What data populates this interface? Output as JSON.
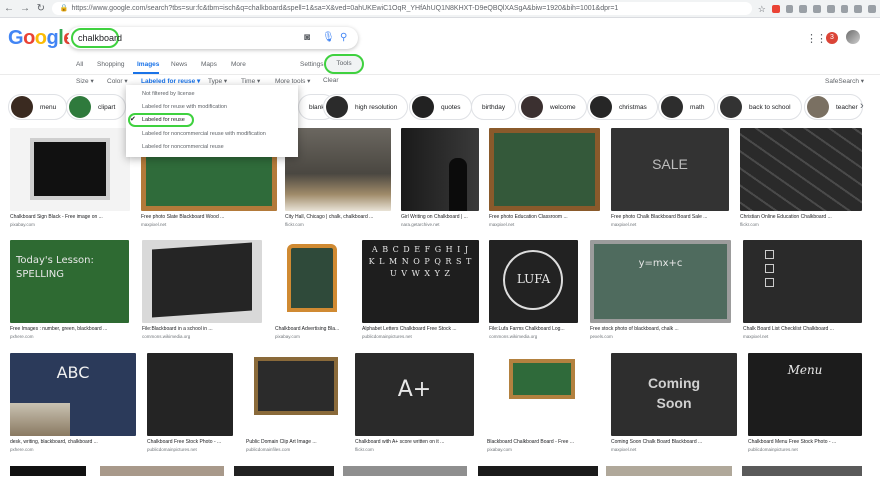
{
  "browser": {
    "url": "https://www.google.com/search?tbs=sur:fc&tbm=isch&q=chalkboard&spell=1&sa=X&ved=0ahUKEwiC1OqR_YHfAhUQ1N8KHXT-D9eQBQlXASgA&biw=1920&bih=1001&dpr=1"
  },
  "logo": [
    "G",
    "o",
    "o",
    "g",
    "l",
    "e"
  ],
  "search": {
    "query": "chalkboard"
  },
  "tabs": {
    "all": "All",
    "shopping": "Shopping",
    "images": "Images",
    "news": "News",
    "maps": "Maps",
    "more": "More",
    "settings": "Settings",
    "tools": "Tools"
  },
  "filters": {
    "size": "Size ▾",
    "color": "Color ▾",
    "usage": "Labeled for reuse ▾",
    "type": "Type ▾",
    "time": "Time ▾",
    "more_tools": "More tools ▾",
    "clear": "Clear",
    "safesearch": "SafeSearch ▾"
  },
  "header": {
    "notifications": "3"
  },
  "dropdown": {
    "items": [
      "Not filtered by license",
      "Labeled for reuse with modification",
      "Labeled for reuse",
      "Labeled for noncommercial reuse with modification",
      "Labeled for noncommercial reuse"
    ],
    "selected_index": 2
  },
  "chips": [
    "menu",
    "clipart",
    "blank",
    "high resolution",
    "quotes",
    "birthday",
    "welcome",
    "christmas",
    "math",
    "back to school",
    "teacher"
  ],
  "results": {
    "row1": [
      {
        "caption": "Chalkboard Sign Black - Free image on ...",
        "source": "pixabay.com"
      },
      {
        "caption": "Free photo Slate Blackboard Wood ...",
        "source": "maxpixel.net"
      },
      {
        "caption": "City Hall, Chicago | chalk, chalkboard ...",
        "source": "flickr.com"
      },
      {
        "caption": "Girl Writing on Chalkboard | ...",
        "source": "nara.getarchive.net"
      },
      {
        "caption": "Free photo Education Classroom ...",
        "source": "maxpixel.net"
      },
      {
        "caption": "Free photo Chalk Blackboard Board Sale ...",
        "source": "maxpixel.net"
      },
      {
        "caption": "Christian Online Education Chalkboard ...",
        "source": "flickr.com"
      }
    ],
    "row2": [
      {
        "caption": "Free Images : number, green, blackboard ...",
        "source": "pxhere.com"
      },
      {
        "caption": "File:Blackboard in a school in ...",
        "source": "commons.wikimedia.org"
      },
      {
        "caption": "Chalkboard Advertising Bla...",
        "source": "pixabay.com"
      },
      {
        "caption": "Alphabet Letters Chalkboard Free Stock ...",
        "source": "publicdomainpictures.net"
      },
      {
        "caption": "File:Lufa Farms Chalkboard Log...",
        "source": "commons.wikimedia.org"
      },
      {
        "caption": "Free stock photo of blackboard, chalk ...",
        "source": "pexels.com"
      },
      {
        "caption": "Chalk Board List Checklist Chalkboard ...",
        "source": "maxpixel.net"
      }
    ],
    "row3": [
      {
        "caption": "desk, writing, blackboard, chalkboard ...",
        "source": "pxhere.com"
      },
      {
        "caption": "Chalkboard Free Stock Photo - ...",
        "source": "publicdomainpictures.net"
      },
      {
        "caption": "Public Domain Clip Art Image ...",
        "source": "publicdomainfiles.com"
      },
      {
        "caption": "Chalkboard with A+ score written on it ...",
        "source": "flickr.com"
      },
      {
        "caption": "Blackboard Chalkboard Board - Free ...",
        "source": "pixabay.com"
      },
      {
        "caption": "Coming Soon Chalk Board Blackboard ...",
        "source": "maxpixel.net"
      },
      {
        "caption": "Chalkboard Menu Free Stock Photo - ...",
        "source": "publicdomainpictures.net"
      }
    ]
  },
  "board_text": {
    "sale": "SALE",
    "lesson": "Today's Lesson: SPELLING",
    "alphabet": "A B C D E F G H I J K L M N O P Q R S T U V W X Y Z",
    "lufa": "LUFA",
    "math": "y=mx+c",
    "abc": "ABC",
    "aplus": "A+",
    "coming_soon": "Coming Soon",
    "menu": "Menu"
  }
}
